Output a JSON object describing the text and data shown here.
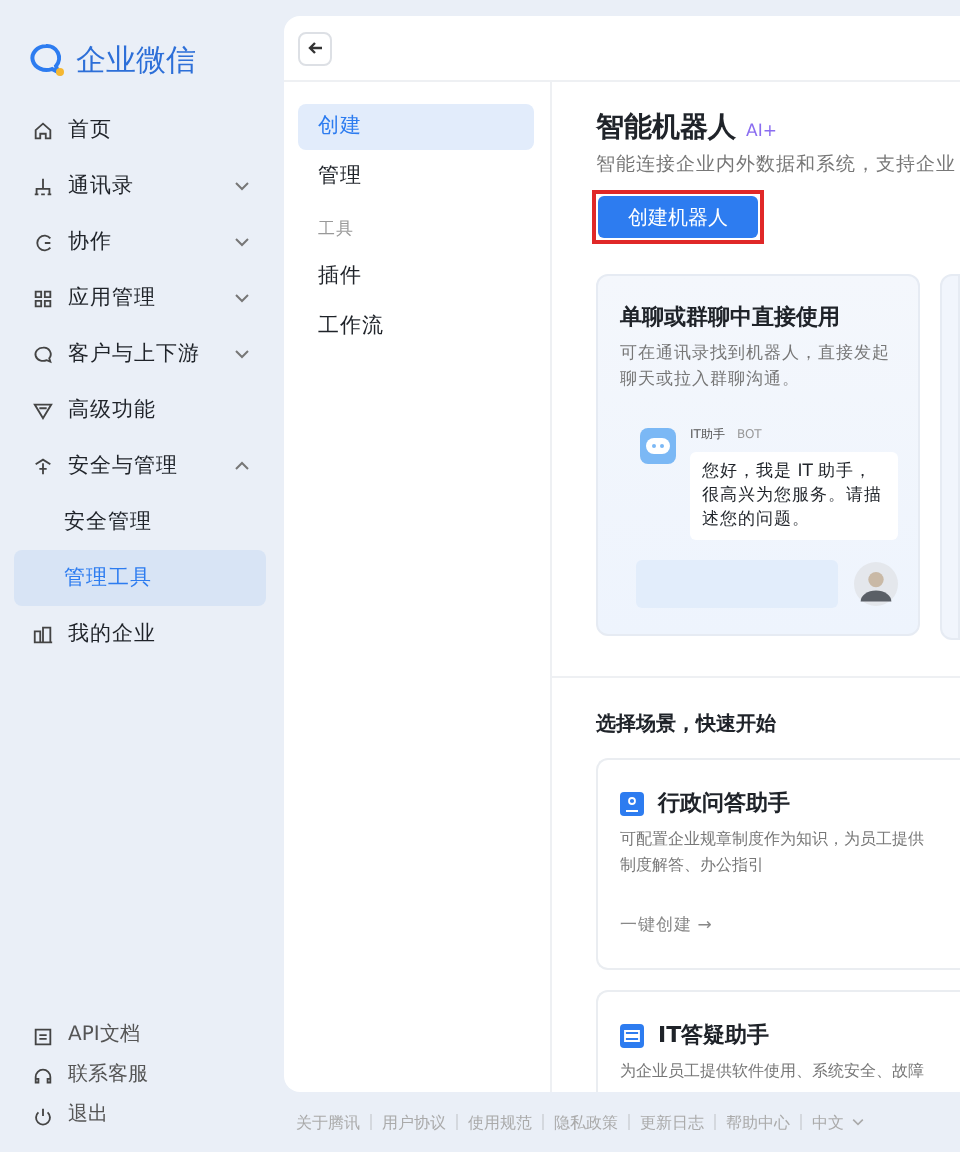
{
  "logo": {
    "text": "企业微信"
  },
  "sidebar": {
    "items": [
      {
        "label": "首页",
        "selected": false
      },
      {
        "label": "通讯录",
        "expanded": false,
        "selected": false
      },
      {
        "label": "协作",
        "expanded": false,
        "selected": false
      },
      {
        "label": "应用管理",
        "expanded": false,
        "selected": false
      },
      {
        "label": "客户与上下游",
        "expanded": false,
        "selected": false
      },
      {
        "label": "高级功能",
        "selected": false
      },
      {
        "label": "安全与管理",
        "expanded": true,
        "selected": false,
        "children": [
          {
            "label": "安全管理",
            "selected": false
          },
          {
            "label": "管理工具",
            "selected": true
          }
        ]
      },
      {
        "label": "我的企业",
        "selected": false
      }
    ],
    "bottom": [
      {
        "label": "API文档"
      },
      {
        "label": "联系客服"
      },
      {
        "label": "退出"
      }
    ]
  },
  "subnav": [
    {
      "kind": "item",
      "label": "创建",
      "selected": true
    },
    {
      "kind": "item",
      "label": "管理",
      "selected": false
    },
    {
      "kind": "heading",
      "label": "工具"
    },
    {
      "kind": "item",
      "label": "插件",
      "selected": false
    },
    {
      "kind": "item",
      "label": "工作流",
      "selected": false
    }
  ],
  "content": {
    "title": "智能机器人",
    "title_badge": "AI+",
    "subtitle": "智能连接企业内外数据和系统，支持企业",
    "button": "创建机器人",
    "feature_card": {
      "title": "单聊或群聊中直接使用",
      "description": "可在通讯录找到机器人，直接发起聊天或拉入群聊沟通。",
      "chat": {
        "name": "IT助手",
        "tag": "BOT",
        "message": "您好，我是 IT 助手，很高兴为您服务。请描述您的问题。"
      }
    },
    "section_title": "选择场景，快速开始",
    "scenarios": [
      {
        "title": "行政问答助手",
        "description": "可配置企业规章制度作为知识，为员工提供制度解答、办公指引",
        "action": "一键创建 →"
      },
      {
        "title": "IT答疑助手",
        "description": "为企业员工提供软件使用、系统安全、故障"
      }
    ]
  },
  "footer": {
    "links": [
      "关于腾讯",
      "用户协议",
      "使用规范",
      "隐私政策",
      "更新日志",
      "帮助中心"
    ],
    "language": "中文"
  }
}
